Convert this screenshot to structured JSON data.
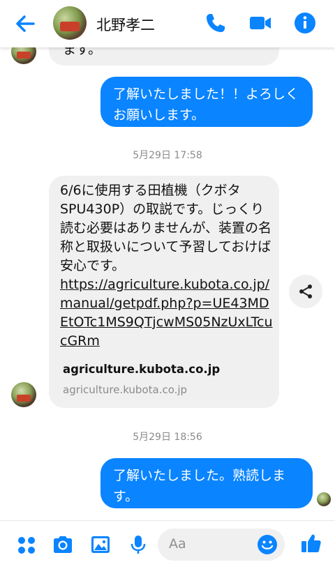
{
  "header": {
    "contact_name": "北野孝二"
  },
  "messages": {
    "prev_tail": "ます。",
    "out1": "了解いたしました！！よろしくお願いします。",
    "ts1": "5月29日 17:58",
    "in1_text": "6/6に使用する田植機（クボタSPU430P）の取説です。じっくり読む必要はありませんが、装置の名称と取扱いについて予習しておけば安心です。",
    "in1_link": "https://agriculture.kubota.co.jp/manual/getpdf.php?p=UE43MDEtOTc1MS9QTjcwMS05NzUxLTcucGRm",
    "preview_title": "agriculture.kubota.co.jp",
    "preview_domain": "agriculture.kubota.co.jp",
    "ts2": "5月29日 18:56",
    "out2": "了解いたしました。熟読します。"
  },
  "composer": {
    "placeholder": "Aa"
  },
  "colors": {
    "accent": "#0a84ff",
    "bubble_in": "#f0f0f0",
    "timestamp": "#8a8a8a"
  },
  "icons": [
    "back-arrow-icon",
    "phone-icon",
    "video-camera-icon",
    "info-icon",
    "share-icon",
    "apps-grid-icon",
    "camera-icon",
    "image-icon",
    "microphone-icon",
    "emoji-icon",
    "thumbs-up-icon"
  ]
}
